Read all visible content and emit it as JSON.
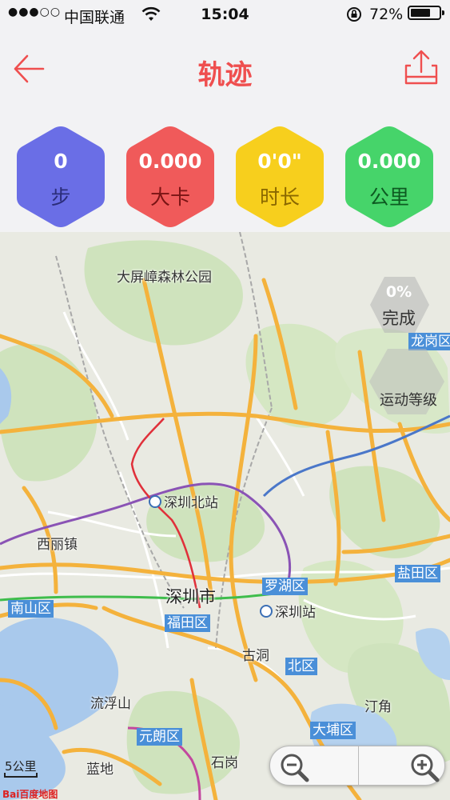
{
  "status_bar": {
    "signal": "●●●○○",
    "carrier": "中国联通",
    "time": "15:04",
    "battery_percent": "72%",
    "battery_level": 0.72
  },
  "nav": {
    "title": "轨迹"
  },
  "stats": [
    {
      "value": "0",
      "label": "步",
      "color": "#6a6ee6",
      "label_color": "#2b2d7a"
    },
    {
      "value": "0.000",
      "label": "大卡",
      "color": "#f05a5a",
      "label_color": "#7a1414"
    },
    {
      "value": "0'0\"",
      "label": "时长",
      "color": "#f7cf1d",
      "label_color": "#8a6800"
    },
    {
      "value": "0.000",
      "label": "公里",
      "color": "#46d46a",
      "label_color": "#0d5a21"
    }
  ],
  "progress": {
    "percent": "0%",
    "label": "完成"
  },
  "level": {
    "label": "运动等级"
  },
  "map": {
    "places": {
      "park": "大屏嶂森林公园",
      "longgang": "龙岗区",
      "shenzhen_north": "深圳北站",
      "xili": "西丽镇",
      "luohu": "罗湖区",
      "yantian": "盐田区",
      "nanshan": "南山区",
      "shenzhen_city": "深圳市",
      "futian": "福田区",
      "shenzhen_station": "深圳站",
      "gudong": "古洞",
      "north_district": "北区",
      "liufushan": "流浮山",
      "tingjiao": "汀角",
      "yuanlang": "元朗区",
      "dabu": "大埔区",
      "landi": "蓝地",
      "shigang": "石岗"
    },
    "scale": "5公里",
    "logo": "Bai百度地图"
  }
}
